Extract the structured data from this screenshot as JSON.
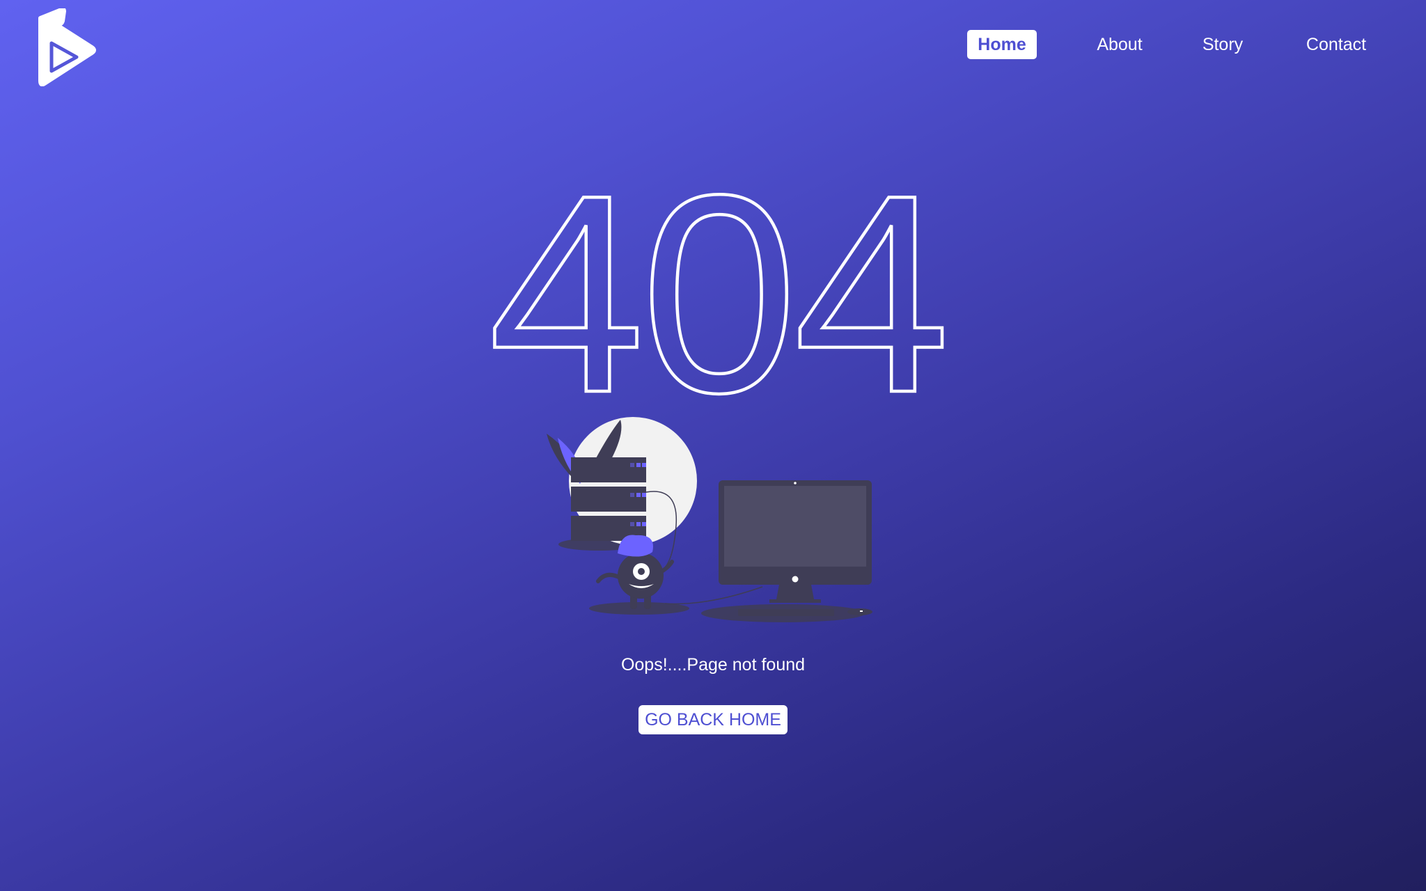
{
  "logo": {
    "icon": "play-logo-icon"
  },
  "nav": {
    "items": [
      {
        "label": "Home",
        "active": true
      },
      {
        "label": "About",
        "active": false
      },
      {
        "label": "Story",
        "active": false
      },
      {
        "label": "Contact",
        "active": false
      }
    ]
  },
  "error": {
    "code": "404",
    "message": "Oops!....Page not found",
    "button_label": "GO BACK HOME"
  },
  "illustration": {
    "icon": "server-monster-computer-illustration"
  },
  "colors": {
    "accent": "#4e4fd2",
    "accent_illustration": "#6c63ff",
    "dark": "#3f3d56",
    "text": "#ffffff"
  }
}
